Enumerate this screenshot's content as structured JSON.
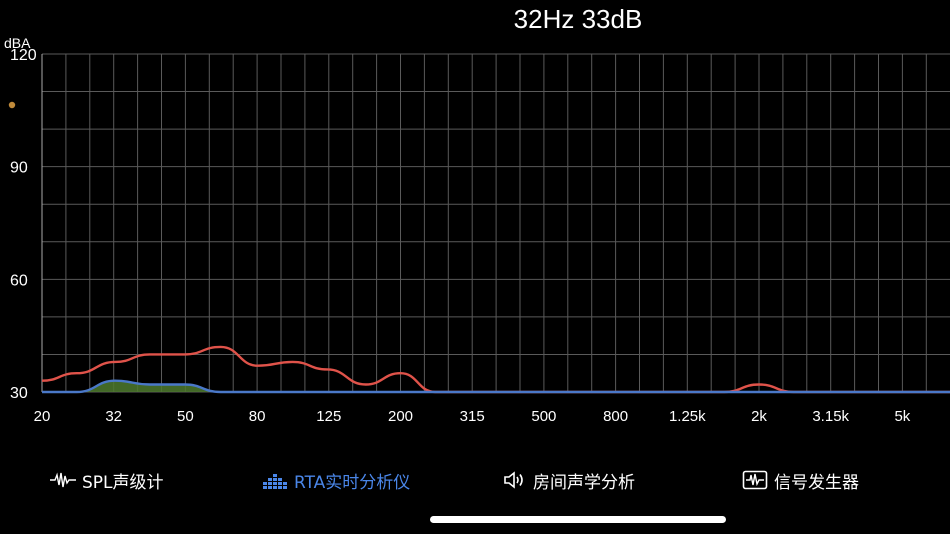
{
  "readout": "32Hz 33dB",
  "tabs": {
    "spl": {
      "label": "SPL声级计",
      "icon": "waveform-icon"
    },
    "rta": {
      "label": "RTA实时分析仪",
      "icon": "bars-icon",
      "active": true
    },
    "room": {
      "label": "房间声学分析",
      "icon": "speaker-icon"
    },
    "gen": {
      "label": "信号发生器",
      "icon": "oscilloscope-icon"
    }
  },
  "colors": {
    "active_tab": "#4a86e8",
    "peak_line": "#e0534a",
    "current_line": "#4a78c8",
    "current_fill": "#4d7a2e",
    "grid": "#5a5a5a",
    "indicator_dot": "#c08a3a"
  },
  "chart_data": {
    "type": "area",
    "ylabel": "dBA",
    "ylim": [
      30,
      120
    ],
    "yticks": [
      30,
      60,
      90,
      120
    ],
    "xscale": "log",
    "x_tick_labels": [
      "20",
      "32",
      "50",
      "80",
      "125",
      "200",
      "315",
      "500",
      "800",
      "1.25k",
      "2k",
      "3.15k",
      "5k"
    ],
    "grid": true,
    "series": [
      {
        "style": "line",
        "color": "#e0534a",
        "points": [
          [
            "20",
            33
          ],
          [
            "25",
            35
          ],
          [
            "32",
            38
          ],
          [
            "40",
            40
          ],
          [
            "50",
            40
          ],
          [
            "63",
            42
          ],
          [
            "80",
            37
          ],
          [
            "100",
            38
          ],
          [
            "125",
            36
          ],
          [
            "160",
            32
          ],
          [
            "200",
            35
          ],
          [
            "250",
            30
          ],
          [
            "1.6k",
            30
          ],
          [
            "2k",
            32
          ],
          [
            "2.5k",
            30
          ],
          [
            "6.3k",
            30
          ]
        ]
      },
      {
        "style": "area",
        "color": "#4a78c8",
        "fill": "#4d7a2e",
        "points": [
          [
            "20",
            30
          ],
          [
            "25",
            30
          ],
          [
            "32",
            33
          ],
          [
            "40",
            32
          ],
          [
            "50",
            32
          ],
          [
            "63",
            30
          ],
          [
            "6.3k",
            30
          ]
        ]
      }
    ]
  }
}
